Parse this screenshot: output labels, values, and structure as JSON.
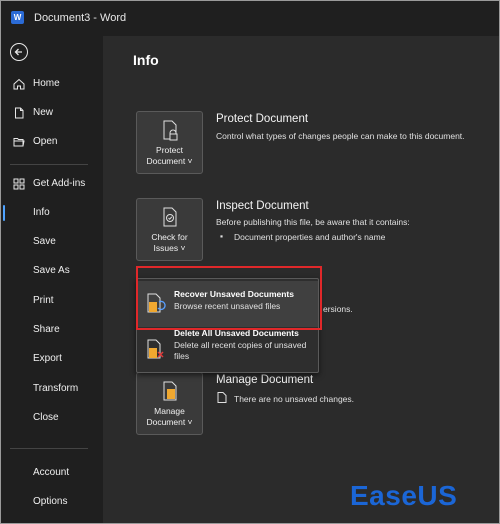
{
  "window": {
    "app_icon_letter": "W",
    "title": "Document3  -  Word"
  },
  "sidebar": {
    "items": [
      {
        "label": "Home",
        "icon": "home-icon"
      },
      {
        "label": "New",
        "icon": "new-document-icon"
      },
      {
        "label": "Open",
        "icon": "open-folder-icon"
      },
      {
        "label": "Get Add-ins",
        "icon": "add-ins-icon"
      },
      {
        "label": "Info",
        "active": true
      },
      {
        "label": "Save"
      },
      {
        "label": "Save As"
      },
      {
        "label": "Print"
      },
      {
        "label": "Share"
      },
      {
        "label": "Export"
      },
      {
        "label": "Transform"
      },
      {
        "label": "Close"
      }
    ],
    "bottom_items": [
      {
        "label": "Account"
      },
      {
        "label": "Options"
      }
    ]
  },
  "main": {
    "title": "Info",
    "protect": {
      "tile_line1": "Protect",
      "tile_line2": "Document ˅",
      "title": "Protect Document",
      "desc": "Control what types of changes people can make to this document."
    },
    "inspect": {
      "tile_line1": "Check for",
      "tile_line2": "Issues ˅",
      "title": "Inspect Document",
      "desc": "Before publishing this file, be aware that it contains:",
      "bullet": "Document properties and author's name",
      "partial_text": "ersions."
    },
    "manage": {
      "tile_line1": "Manage",
      "tile_line2": "Document ˅",
      "title": "Manage Document",
      "desc": "There are no unsaved changes."
    },
    "dropdown": {
      "items": [
        {
          "title": "Recover Unsaved Documents",
          "desc": "Browse recent unsaved files",
          "highlighted": true
        },
        {
          "title": "Delete All Unsaved Documents",
          "desc": "Delete all recent copies of unsaved files"
        }
      ]
    }
  },
  "watermark": {
    "text": "EaseUS"
  },
  "colors": {
    "accent": "#4fa3ff",
    "highlight_box": "#e0282a",
    "logo": "#1b66d6",
    "folder": "#f0a830"
  }
}
